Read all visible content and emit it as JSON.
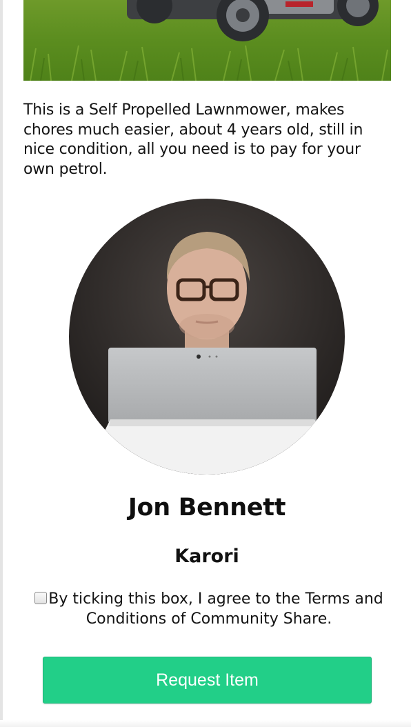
{
  "listing": {
    "description": "This is a Self Propelled Lawnmower, makes chores much easier, about 4 years old, still in nice condition, all you need is to pay for your own petrol."
  },
  "owner": {
    "name": "Jon Bennett",
    "location": "Karori"
  },
  "terms": {
    "checked": false,
    "label": "By ticking this box, I agree to the Terms and Conditions of Community Share."
  },
  "actions": {
    "request_label": "Request Item"
  },
  "colors": {
    "button": "#22cf88",
    "button_text": "#ffffff",
    "text": "#141414"
  }
}
